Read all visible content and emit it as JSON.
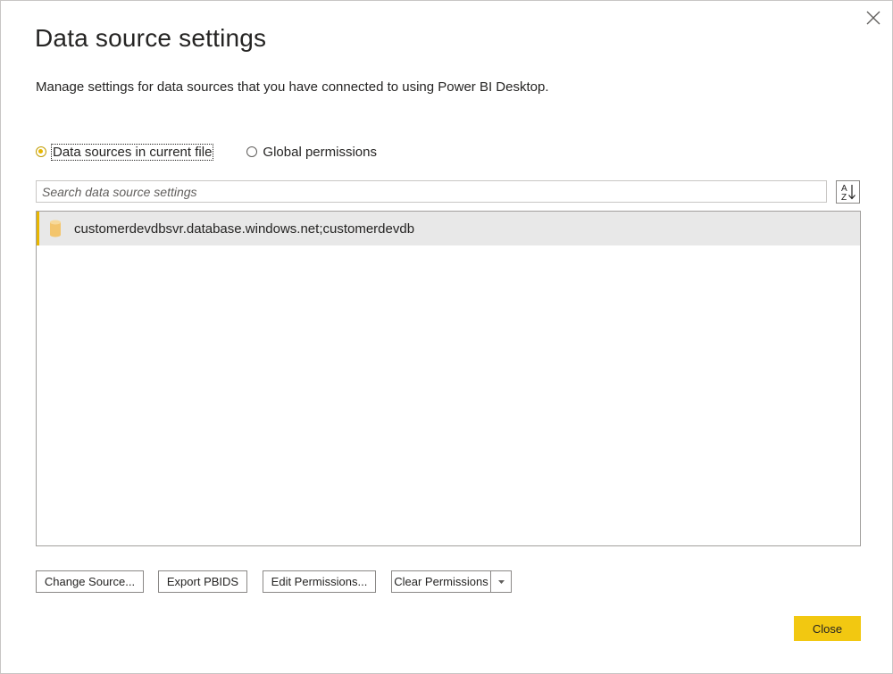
{
  "dialog": {
    "title": "Data source settings",
    "subtitle": "Manage settings for data sources that you have connected to using Power BI Desktop."
  },
  "scope": {
    "options": [
      {
        "label": "Data sources in current file",
        "selected": true
      },
      {
        "label": "Global permissions",
        "selected": false
      }
    ]
  },
  "search": {
    "placeholder": "Search data source settings",
    "value": ""
  },
  "sort": {
    "icon": "sort-az-icon"
  },
  "sources": {
    "items": [
      {
        "label": "customerdevdbsvr.database.windows.net;customerdevdb",
        "icon": "database-icon",
        "selected": true
      }
    ]
  },
  "actions": {
    "change_source": "Change Source...",
    "export_pbids": "Export PBIDS",
    "edit_permissions": "Edit Permissions...",
    "clear_permissions": "Clear Permissions",
    "close": "Close"
  },
  "colors": {
    "accent": "#f2c811",
    "selected_row": "#e8e8e8",
    "border": "#a19f9d"
  }
}
